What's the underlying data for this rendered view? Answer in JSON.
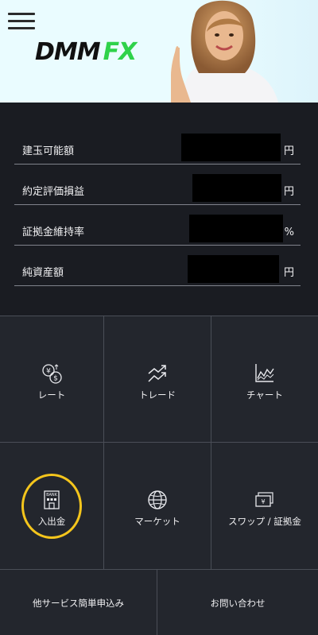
{
  "header": {
    "logo_dmm": "DMM",
    "logo_fx": "FX"
  },
  "summary": {
    "rows": [
      {
        "label": "建玉可能額",
        "unit": "円"
      },
      {
        "label": "約定評価損益",
        "unit": "円"
      },
      {
        "label": "証拠金維持率",
        "unit": "%"
      },
      {
        "label": "純資産額",
        "unit": "円"
      }
    ]
  },
  "menu": {
    "items": [
      {
        "label": "レート",
        "icon": "currency-exchange-icon"
      },
      {
        "label": "トレード",
        "icon": "trend-arrows-icon"
      },
      {
        "label": "チャート",
        "icon": "line-chart-icon"
      },
      {
        "label": "入出金",
        "icon": "bank-icon"
      },
      {
        "label": "マーケット",
        "icon": "globe-icon"
      },
      {
        "label": "スワップ / 証拠金",
        "icon": "yen-bills-icon"
      }
    ],
    "bottom": [
      {
        "label": "他サービス簡単申込み"
      },
      {
        "label": "お問い合わせ"
      }
    ]
  },
  "colors": {
    "brand_green": "#2fd24a",
    "highlight_ring": "#f4c51c",
    "background": "#1a1c22"
  }
}
